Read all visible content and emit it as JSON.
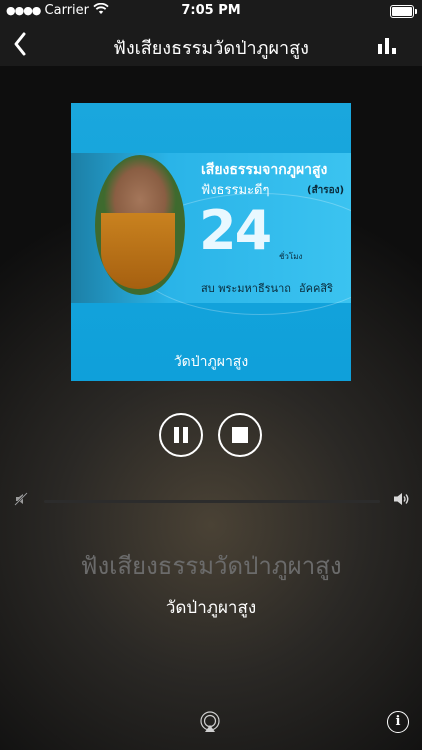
{
  "status": {
    "carrier": "Carrier",
    "time": "7:05 PM"
  },
  "nav": {
    "title": "ฟังเสียงธรรมวัดป่าภูผาสูง"
  },
  "artwork": {
    "line1": "เสียงธรรมจากภูผาสูง",
    "line2": "ฟังธรรมะดีๆ",
    "line3": "(สำรอง)",
    "big_number": "24",
    "hours": "ชั่วโมง",
    "line4": "สบ พระมหาธีรนาถ",
    "line5": "อัคคสิริ",
    "caption": "วัดป่าภูผาสูง"
  },
  "player": {
    "title": "ฟังเสียงธรรมวัดป่าภูผาสูง",
    "subtitle": "วัดป่าภูผาสูง"
  },
  "colors": {
    "accent": "#14a3dc",
    "title_dim": "#6b6b6b"
  },
  "icons": [
    "wifi-icon",
    "back-chevron-icon",
    "equalizer-icon",
    "pause-icon",
    "stop-icon",
    "volume-min-icon",
    "volume-max-icon",
    "airplay-icon",
    "info-icon"
  ]
}
